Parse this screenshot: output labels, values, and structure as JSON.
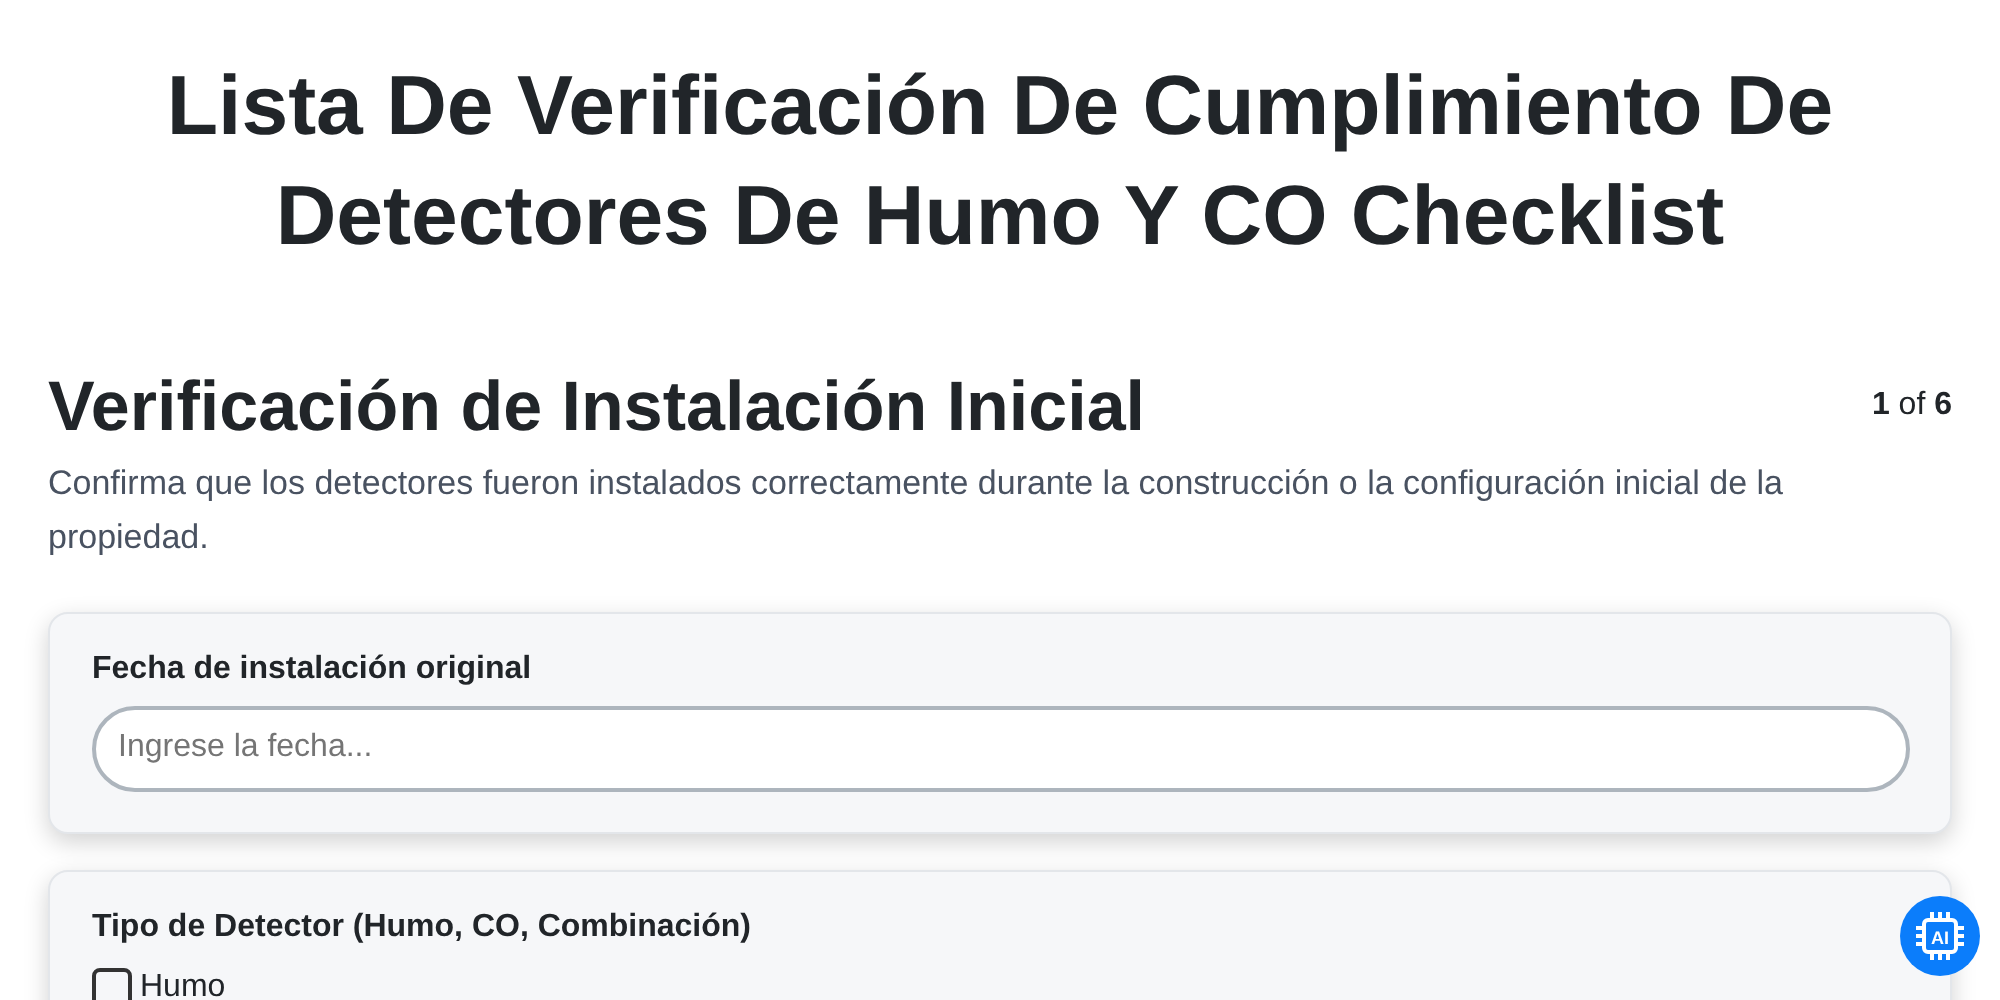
{
  "title": "Lista De Verificación De Cumplimiento De Detectores De Humo Y CO Checklist",
  "section": {
    "heading": "Verificación de Instalación Inicial",
    "step": "**1** of **6**",
    "description": "Confirma que los detectores fueron instalados correctamente durante la construcción o la configuración inicial de la propiedad."
  },
  "fields": [
    {
      "kind": "text",
      "label": "Fecha de instalación original",
      "placeholder": "Ingrese la fecha..."
    },
    {
      "kind": "checkboxes",
      "label": "Tipo de Detector (Humo, CO, Combinación)",
      "options": [
        {
          "label": "Humo",
          "checked": false
        }
      ]
    }
  ],
  "ai_button": {
    "label": "AI"
  }
}
